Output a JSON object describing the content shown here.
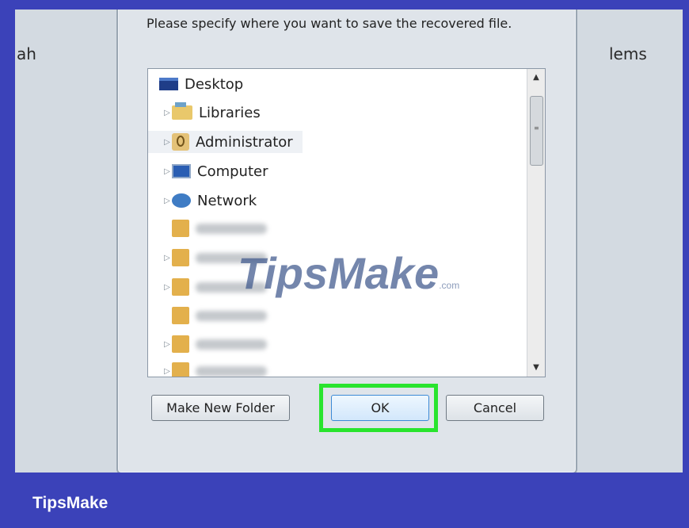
{
  "background": {
    "left_text": "ah",
    "right_text": "lems"
  },
  "dialog": {
    "prompt": "Please specify where you want to save the recovered file.",
    "tree": [
      {
        "label": "Desktop",
        "icon": "desktop-icon"
      },
      {
        "label": "Libraries",
        "icon": "libraries-icon"
      },
      {
        "label": "Administrator",
        "icon": "user-folder-icon"
      },
      {
        "label": "Computer",
        "icon": "computer-icon"
      },
      {
        "label": "Network",
        "icon": "network-icon"
      }
    ],
    "buttons": {
      "make_new_folder": "Make New Folder",
      "ok": "OK",
      "cancel": "Cancel"
    }
  },
  "watermark": {
    "text": "TipsMake",
    "suffix": ".com"
  },
  "footer": {
    "brand": "TipsMake"
  },
  "colors": {
    "frame": "#3b42b9",
    "highlight": "#29e42e"
  }
}
